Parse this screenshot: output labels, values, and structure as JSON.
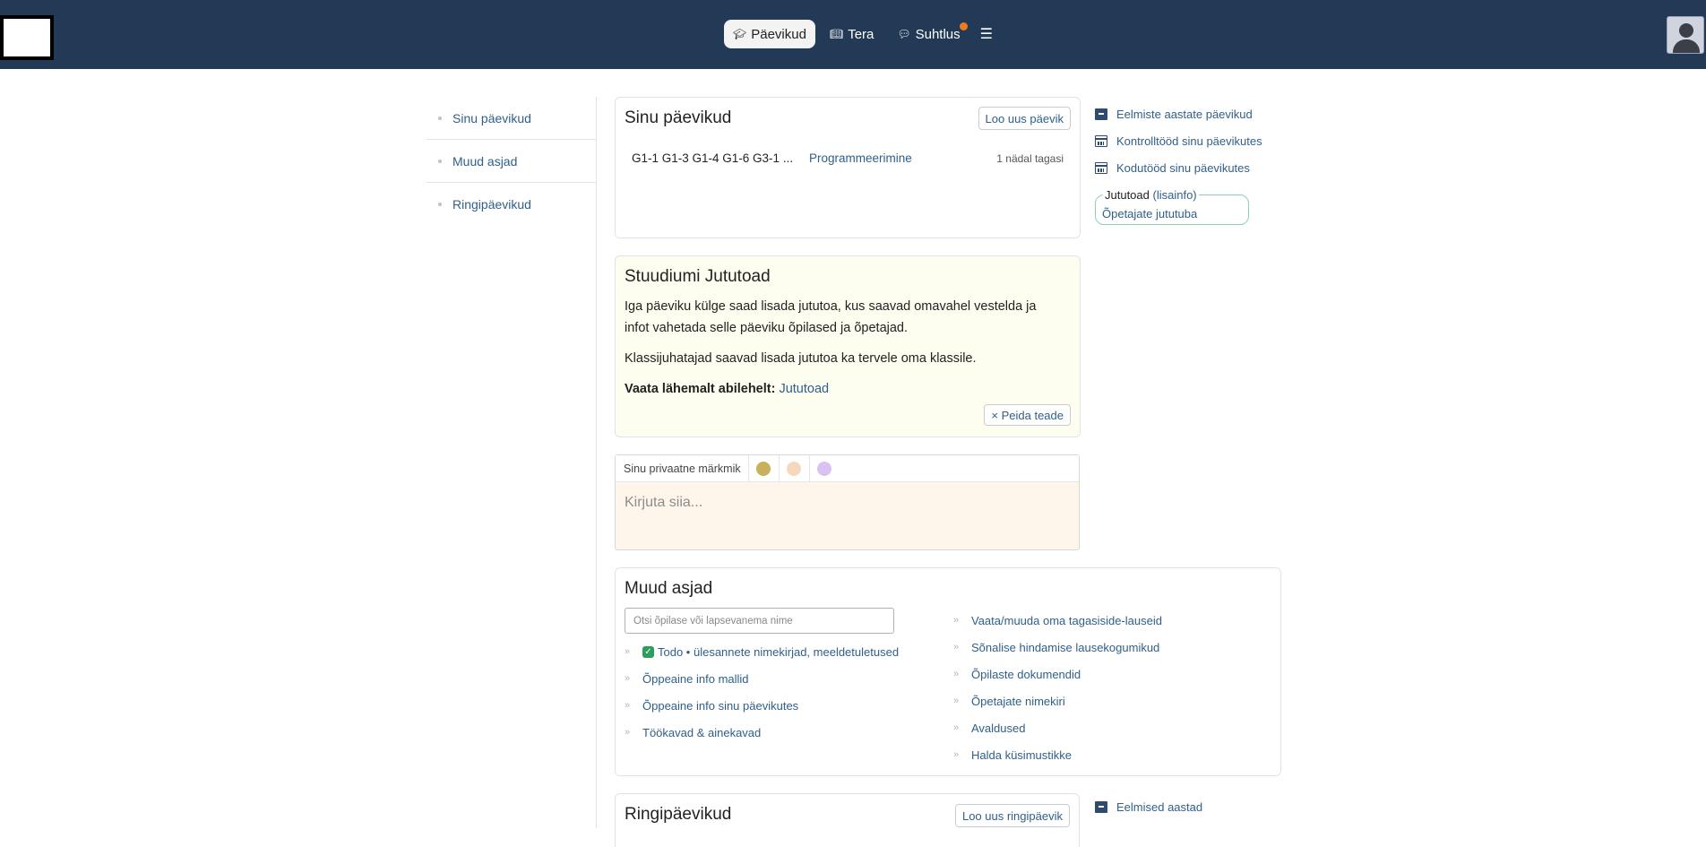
{
  "topnav": {
    "items": [
      {
        "label": "Päevikud",
        "icon": "graduation-cap-icon",
        "active": true
      },
      {
        "label": "Tera",
        "icon": "book-icon"
      },
      {
        "label": "Suhtlus",
        "icon": "chat-bubble-icon",
        "has_notification": true
      }
    ],
    "menu_icon": "hamburger-icon"
  },
  "sidebar": {
    "items": [
      {
        "label": "Sinu päevikud"
      },
      {
        "label": "Muud asjad"
      },
      {
        "label": "Ringipäevikud"
      }
    ]
  },
  "diaries": {
    "title": "Sinu päevikud",
    "new_button": "Loo uus päevik",
    "rows": [
      {
        "groups": "G1-1 G1-3 G1-4 G1-6 G3-1 ...",
        "subject": "Programmeerimine",
        "time": "1 nädal tagasi"
      }
    ]
  },
  "right_links": {
    "items": [
      {
        "label": "Eelmiste aastate päevikud",
        "icon": "archive-icon"
      },
      {
        "label": "Kontrolltööd sinu päevikutes",
        "icon": "calendar-icon"
      },
      {
        "label": "Kodutööd sinu päevikutes",
        "icon": "calendar-icon"
      }
    ]
  },
  "chatrooms": {
    "legend": "Jututoad",
    "legend_link": "(lisainfo)",
    "link": "Õpetajate jututuba"
  },
  "info": {
    "title": "Stuudiumi Jututoad",
    "p1": "Iga päeviku külge saad lisada jututoa, kus saavad omavahel vestelda ja infot vahetada selle päeviku õpilased ja õpetajad.",
    "p2": "Klassijuhatajad saavad lisada jututoa ka tervele oma klassile.",
    "p3_label": "Vaata lähemalt abilehelt:",
    "p3_link": "Jututoad",
    "hide_button": "× Peida teade"
  },
  "notes": {
    "tab_label": "Sinu privaatne märkmik",
    "colors": [
      "#c8b15a",
      "#f6d8bf",
      "#d9c2f2"
    ],
    "placeholder": "Kirjuta siia..."
  },
  "other": {
    "title": "Muud asjad",
    "search_placeholder": "Otsi õpilase või lapsevanema nime",
    "todo_label": "Todo • ülesannete nimekirjad, meeldetuletused",
    "left_items": [
      "Õppeaine info mallid",
      "Õppeaine info sinu päevikutes",
      "Töökavad & ainekavad"
    ],
    "right_items": [
      "Vaata/muuda oma tagasiside-lauseid",
      "Sõnalise hindamise lausekogumikud",
      "Õpilaste dokumendid",
      "Õpetajate nimekiri",
      "Avaldused",
      "Halda küsimustikke"
    ]
  },
  "ringi": {
    "title": "Ringipäevikud",
    "new_button": "Loo uus ringipäevik",
    "side_link": "Eelmised aastad"
  }
}
